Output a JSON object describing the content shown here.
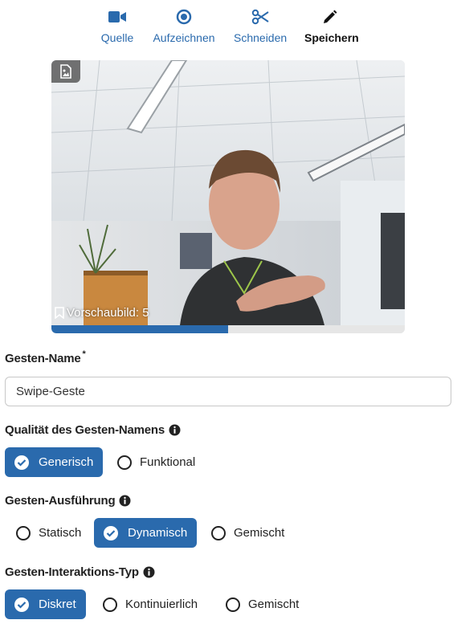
{
  "toolbar": {
    "items": [
      {
        "label": "Quelle",
        "icon": "video-camera-icon"
      },
      {
        "label": "Aufzeichnen",
        "icon": "record-icon"
      },
      {
        "label": "Schneiden",
        "icon": "scissors-icon"
      },
      {
        "label": "Speichern",
        "icon": "pencil-icon",
        "active": true
      }
    ],
    "accent": "#2a6aad"
  },
  "preview": {
    "thumbnail_label": "Vorschaubild: 5",
    "progress": 0.5
  },
  "form": {
    "gesture_name": {
      "label": "Gesten-Name",
      "required_mark": "*",
      "value": "Swipe-Geste"
    },
    "name_quality": {
      "label": "Qualität des Gesten-Namens",
      "options": [
        "Generisch",
        "Funktional"
      ],
      "selected": "Generisch"
    },
    "execution": {
      "label": "Gesten-Ausführung",
      "options": [
        "Statisch",
        "Dynamisch",
        "Gemischt"
      ],
      "selected": "Dynamisch"
    },
    "interaction_type": {
      "label": "Gesten-Interaktions-Typ",
      "options": [
        "Diskret",
        "Kontinuierlich",
        "Gemischt"
      ],
      "selected": "Diskret"
    }
  }
}
